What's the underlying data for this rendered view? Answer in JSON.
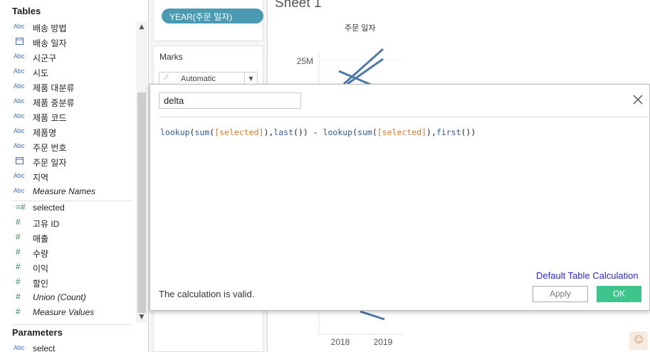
{
  "data_pane": {
    "tables_title": "Tables",
    "dimensions": [
      {
        "type_icon": "Abc",
        "label": "배송 방법",
        "italic": false
      },
      {
        "type_icon": "calendar-icon",
        "label": "배송 일자",
        "italic": false
      },
      {
        "type_icon": "Abc",
        "label": "시군구",
        "italic": false
      },
      {
        "type_icon": "Abc",
        "label": "시도",
        "italic": false
      },
      {
        "type_icon": "Abc",
        "label": "제품 대분류",
        "italic": false
      },
      {
        "type_icon": "Abc",
        "label": "제품 중분류",
        "italic": false
      },
      {
        "type_icon": "Abc",
        "label": "제품 코드",
        "italic": false
      },
      {
        "type_icon": "Abc",
        "label": "제품명",
        "italic": false
      },
      {
        "type_icon": "Abc",
        "label": "주문 번호",
        "italic": false
      },
      {
        "type_icon": "calendar-icon",
        "label": "주문 일자",
        "italic": false
      },
      {
        "type_icon": "Abc",
        "label": "지역",
        "italic": false
      },
      {
        "type_icon": "Abc",
        "label": "Measure Names",
        "italic": true
      }
    ],
    "measures": [
      {
        "type_icon": "=#",
        "label": "selected",
        "italic": false
      },
      {
        "type_icon": "#",
        "label": "고유 ID",
        "italic": false
      },
      {
        "type_icon": "#",
        "label": "매출",
        "italic": false
      },
      {
        "type_icon": "#",
        "label": "수량",
        "italic": false
      },
      {
        "type_icon": "#",
        "label": "이익",
        "italic": false
      },
      {
        "type_icon": "#",
        "label": "할인",
        "italic": false
      },
      {
        "type_icon": "#",
        "label": "Union (Count)",
        "italic": true
      },
      {
        "type_icon": "#",
        "label": "Measure Values",
        "italic": true
      }
    ],
    "parameters_title": "Parameters",
    "parameters": [
      {
        "type_icon": "Abc",
        "label": "select"
      }
    ]
  },
  "shelves": {
    "column_pill": "YEAR(주문 일자)",
    "marks_title": "Marks",
    "marks_type": "Automatic"
  },
  "view": {
    "sheet_title": "Sheet 1",
    "column_header": "주문 일자",
    "y_tick_label": "25M",
    "x_tick_labels": [
      "2018",
      "2019"
    ]
  },
  "calc_dialog": {
    "name": "delta",
    "formula_tokens": [
      {
        "t": "fn",
        "v": "lookup"
      },
      {
        "t": "op",
        "v": "("
      },
      {
        "t": "fn",
        "v": "sum"
      },
      {
        "t": "op",
        "v": "("
      },
      {
        "t": "field",
        "v": "[selected]"
      },
      {
        "t": "op",
        "v": "),"
      },
      {
        "t": "fn",
        "v": "last"
      },
      {
        "t": "op",
        "v": "()) - "
      },
      {
        "t": "fn",
        "v": "lookup"
      },
      {
        "t": "op",
        "v": "("
      },
      {
        "t": "fn",
        "v": "sum"
      },
      {
        "t": "op",
        "v": "("
      },
      {
        "t": "field",
        "v": "[selected]"
      },
      {
        "t": "op",
        "v": "),"
      },
      {
        "t": "fn",
        "v": "first"
      },
      {
        "t": "op",
        "v": "())"
      }
    ],
    "default_table_calc_link": "Default Table Calculation",
    "status": "The calculation is valid.",
    "apply_label": "Apply",
    "ok_label": "OK"
  },
  "colors": {
    "pill": "#4b9ab3",
    "line": "#4e79a7",
    "ok_button": "#3ec48d",
    "link": "#2a2aca",
    "formula_function": "#2f5b9a",
    "formula_field": "#d4792a"
  }
}
